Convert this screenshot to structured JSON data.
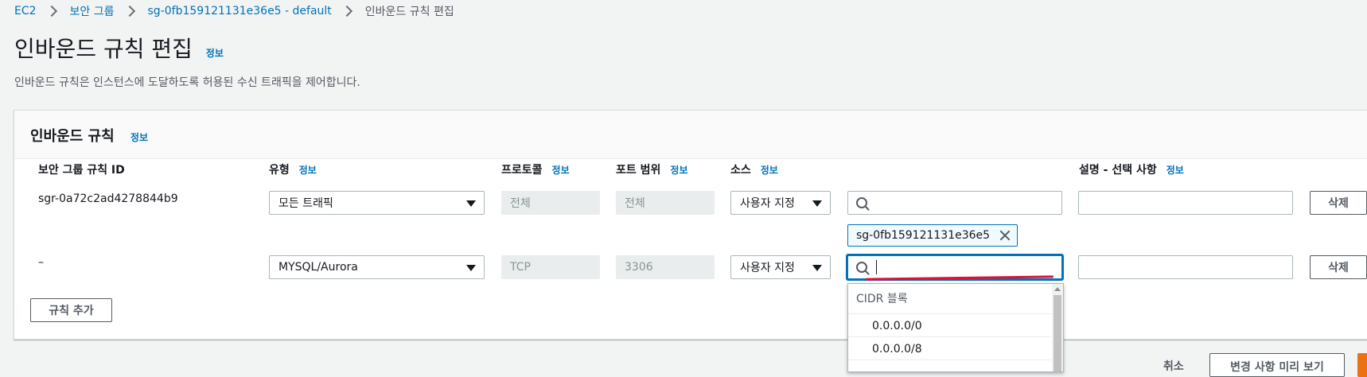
{
  "breadcrumb": {
    "items": [
      "EC2",
      "보안 그룹",
      "sg-0fb159121131e36e5 - default"
    ],
    "current": "인바운드 규칙 편집"
  },
  "page": {
    "title": "인바운드 규칙 편집",
    "info": "정보",
    "subtitle": "인바운드 규칙은 인스턴스에 도달하도록 허용된 수신 트래픽을 제어합니다."
  },
  "panel": {
    "title": "인바운드 규칙",
    "info": "정보"
  },
  "columns": {
    "rule_id": "보안 그룹 규칙 ID",
    "type": "유형",
    "protocol": "프로토콜",
    "port_range": "포트 범위",
    "source": "소스",
    "description": "설명 - 선택 사항",
    "info": "정보"
  },
  "rows": [
    {
      "rule_id": "sgr-0a72c2ad4278844b9",
      "type": "모든 트래픽",
      "protocol": "전체",
      "port_range": "전체",
      "source_type": "사용자 지정",
      "source_value": "",
      "source_token": "sg-0fb159121131e36e5",
      "description": "",
      "delete_label": "삭제"
    },
    {
      "rule_id": "–",
      "type": "MYSQL/Aurora",
      "protocol": "TCP",
      "port_range": "3306",
      "source_type": "사용자 지정",
      "source_value": "",
      "description": "",
      "delete_label": "삭제"
    }
  ],
  "add_rule_label": "규칙 추가",
  "dropdown": {
    "group_label": "CIDR 블록",
    "options": [
      "0.0.0.0/0",
      "0.0.0.0/8"
    ]
  },
  "footer": {
    "cancel_label": "취소",
    "preview_label": "변경 사항 미리 보기"
  },
  "colors": {
    "link": "#0073bb",
    "focus": "#0073bb",
    "annotation_line": "#e0102f",
    "primary": "#ec7211"
  }
}
